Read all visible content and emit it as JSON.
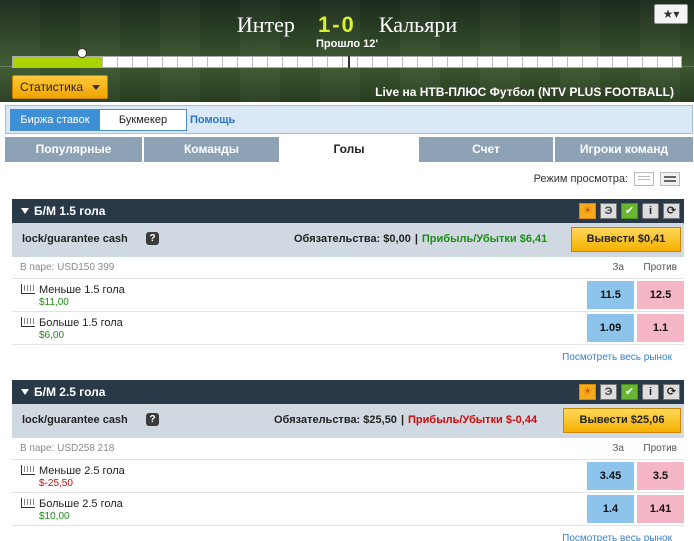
{
  "header": {
    "home_team": "Интер",
    "score": "1-0",
    "away_team": "Кальяри",
    "elapsed": "Прошло 12'",
    "favorite_icon": "★▾",
    "timeline_progress": 0.133,
    "stats_button": "Статистика",
    "live_text": "Live на НТВ-ПЛЮС Футбол (NTV PLUS FOOTBALL)"
  },
  "modebar": {
    "exchange": "Биржа ставок",
    "bookmaker": "Букмекер",
    "help": "Помощь"
  },
  "tabs": [
    {
      "label": "Популярные"
    },
    {
      "label": "Команды"
    },
    {
      "label": "Голы"
    },
    {
      "label": "Счет"
    },
    {
      "label": "Игроки команд"
    }
  ],
  "view_mode_label": "Режим просмотра:",
  "markets": [
    {
      "title": "Б/М 1.5 гола",
      "cash_label": "lock/guarantee cash",
      "obligations": "Обязательства: $0,00",
      "pl": "Прибыль/Убытки $6,41",
      "pl_color": "#1b8d13",
      "cashout": "Вывести $0,41",
      "matched": "В паре: USD150 399",
      "back_header": "За",
      "lay_header": "Против",
      "runners": [
        {
          "name": "Меньше 1.5 гола",
          "pos": "$11,00",
          "back": "11.5",
          "lay": "12.5"
        },
        {
          "name": "Больше 1.5 гола",
          "pos": "$6,00",
          "back": "1.09",
          "lay": "1.1"
        }
      ],
      "more": "Посмотреть весь рынок"
    },
    {
      "title": "Б/М 2.5 гола",
      "cash_label": "lock/guarantee cash",
      "obligations": "Обязательства: $25,50",
      "pl": "Прибыль/Убытки $-0,44",
      "pl_color": "#cc0b0b",
      "cashout": "Вывести $25,06",
      "matched": "В паре: USD258 218",
      "back_header": "За",
      "lay_header": "Против",
      "runners": [
        {
          "name": "Меньше 2.5 гола",
          "pos": "$-25,50",
          "back": "3.45",
          "lay": "3.5"
        },
        {
          "name": "Больше 2.5 гола",
          "pos": "$10,00",
          "back": "1.4",
          "lay": "1.41"
        }
      ],
      "more": "Посмотреть весь рынок"
    }
  ]
}
